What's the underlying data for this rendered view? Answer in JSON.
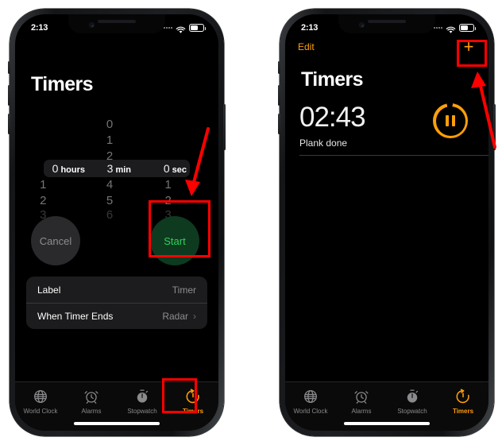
{
  "status_bar": {
    "time": "2:13",
    "wifi_icon": "wifi-icon",
    "battery_icon": "battery-icon",
    "cellular_icon": "cellular-dots-icon"
  },
  "left_phone": {
    "title": "Timers",
    "picker": {
      "hours": {
        "above": [],
        "selected_value": "0",
        "selected_unit": "hours",
        "below": [
          "1",
          "2",
          "3"
        ]
      },
      "minutes": {
        "above": [
          "0",
          "1",
          "2"
        ],
        "selected_value": "3",
        "selected_unit": "min",
        "below": [
          "4",
          "5",
          "6"
        ]
      },
      "seconds": {
        "above": [],
        "selected_value": "0",
        "selected_unit": "sec",
        "below": [
          "1",
          "2",
          "3"
        ]
      }
    },
    "cancel_label": "Cancel",
    "start_label": "Start",
    "settings": [
      {
        "label": "Label",
        "value": "Timer",
        "chevron": ""
      },
      {
        "label": "When Timer Ends",
        "value": "Radar",
        "chevron": "›"
      }
    ]
  },
  "right_phone": {
    "edit_label": "Edit",
    "add_label": "+",
    "title": "Timers",
    "timer": {
      "remaining": "02:43",
      "label": "Plank done",
      "control_icon": "pause-icon"
    }
  },
  "tab_bar": {
    "items": [
      {
        "label": "World Clock",
        "icon": "globe-icon",
        "active": false
      },
      {
        "label": "Alarms",
        "icon": "alarm-clock-icon",
        "active": false
      },
      {
        "label": "Stopwatch",
        "icon": "stopwatch-icon",
        "active": false
      },
      {
        "label": "Timers",
        "icon": "timer-icon",
        "active": true
      }
    ]
  },
  "annotations": {
    "color": "#ff0000",
    "highlights": [
      "start-button-highlight",
      "timers-tab-highlight",
      "add-timer-button-highlight"
    ],
    "arrows": [
      "arrow-to-start-button",
      "arrow-to-add-timer-button"
    ]
  },
  "colors": {
    "accent_orange": "#ff9f0a",
    "start_green": "#30d158",
    "annotation_red": "#ff0000",
    "screen_black": "#000000"
  }
}
